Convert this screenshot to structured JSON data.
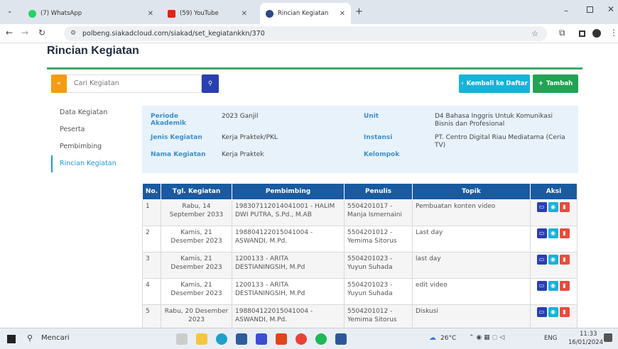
{
  "tabs": [
    {
      "label": "(7) WhatsApp",
      "color": "#25d366"
    },
    {
      "label": "(59) YouTube",
      "color": "#e62117"
    },
    {
      "label": "Rincian Kegiatan",
      "color": "#2a4a8a"
    }
  ],
  "address": {
    "url": "polbeng.siakadcloud.com/siakad/set_kegiatankkn/370"
  },
  "page": {
    "title": "Rincian Kegiatan",
    "search_placeholder": "Cari Kegiatan",
    "back_label": "Kembali ke Daftar",
    "add_label": "Tambah",
    "sidebar": [
      "Data Kegiatan",
      "Peserta",
      "Pembimbing",
      "Rincian Kegiatan"
    ],
    "info": {
      "periode_label": "Periode Akademik",
      "periode": "2023 Ganjil",
      "jenis_label": "Jenis Kegiatan",
      "jenis": "Kerja Praktek/PKL",
      "nama_label": "Nama Kegiatan",
      "nama": "Kerja Praktek",
      "unit_label": "Unit",
      "unit": "D4 Bahasa Inggris Untuk Komunikasi Bisnis dan Profesional",
      "instansi_label": "Instansi",
      "instansi": "PT. Centro Digital Riau Mediatama (Ceria TV)",
      "kelompok_label": "Kelompok"
    },
    "table": {
      "headers": [
        "No.",
        "Tgl. Kegiatan",
        "Pembimbing",
        "Penulis",
        "Topik",
        "Aksi"
      ],
      "rows": [
        {
          "no": "1",
          "tgl": "Rabu, 14 September 2033",
          "pembimbing": "198307112014041001 - HALIM DWI PUTRA, S.Pd., M.AB",
          "penulis": "5504201017 - Manja Ismernaini",
          "topik": "Pembuatan konten video"
        },
        {
          "no": "2",
          "tgl": "Kamis, 21 Desember 2023",
          "pembimbing": "198804122015041004 - ASWANDI, M.Pd.",
          "penulis": "5504201012 - Yemima Sitorus",
          "topik": "Last day"
        },
        {
          "no": "3",
          "tgl": "Kamis, 21 Desember 2023",
          "pembimbing": "1200133 - ARITA DESTIANINGSIH, M.Pd",
          "penulis": "5504201023 - Yuyun Suhada",
          "topik": "last day"
        },
        {
          "no": "4",
          "tgl": "Kamis, 21 Desember 2023",
          "pembimbing": "1200133 - ARITA DESTIANINGSIH, M.Pd",
          "penulis": "5504201023 - Yuyun Suhada",
          "topik": "edit video"
        },
        {
          "no": "5",
          "tgl": "Rabu, 20 Desember 2023",
          "pembimbing": "198804122015041004 - ASWANDI, M.Pd.",
          "penulis": "5504201012 - Yemima Sitorus",
          "topik": "Diskusi"
        }
      ]
    }
  },
  "taskbar": {
    "search": "Mencari",
    "temp": "26°C",
    "lang": "ENG",
    "time": "11:33",
    "date": "16/01/2024"
  }
}
